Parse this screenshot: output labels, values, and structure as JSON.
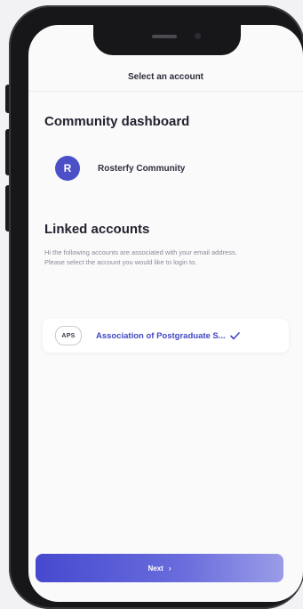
{
  "header": {
    "title": "Select an account"
  },
  "community_section": {
    "title": "Community dashboard",
    "item": {
      "logo_letter": "R",
      "name": "Rosterfy Community"
    }
  },
  "linked_section": {
    "title": "Linked accounts",
    "description": "Hi                   the following accounts are associated with your email address. Please select the account you would like to login to.",
    "accounts": [
      {
        "logo_text": "APS",
        "name": "Association of Postgraduate S...",
        "selected": true
      }
    ]
  },
  "footer": {
    "next_label": "Next",
    "next_arrow": "›"
  },
  "colors": {
    "accent": "#4b4fc8",
    "link": "#4146c2"
  }
}
